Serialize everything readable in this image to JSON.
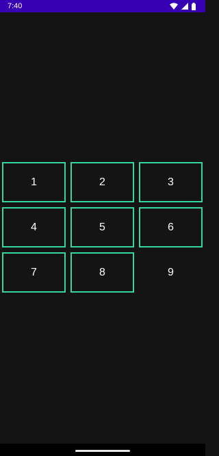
{
  "status_bar": {
    "time": "7:40",
    "icons": [
      "wifi-icon",
      "signal-icon",
      "battery-icon"
    ],
    "background": "#3700b3"
  },
  "grid": {
    "border_color": "#36d6a1",
    "rows": [
      [
        {
          "label": "1",
          "bordered": true
        },
        {
          "label": "2",
          "bordered": true
        },
        {
          "label": "3",
          "bordered": true
        }
      ],
      [
        {
          "label": "4",
          "bordered": true
        },
        {
          "label": "5",
          "bordered": true
        },
        {
          "label": "6",
          "bordered": true
        }
      ],
      [
        {
          "label": "7",
          "bordered": true
        },
        {
          "label": "8",
          "bordered": true
        },
        {
          "label": "9",
          "bordered": false
        }
      ]
    ]
  }
}
